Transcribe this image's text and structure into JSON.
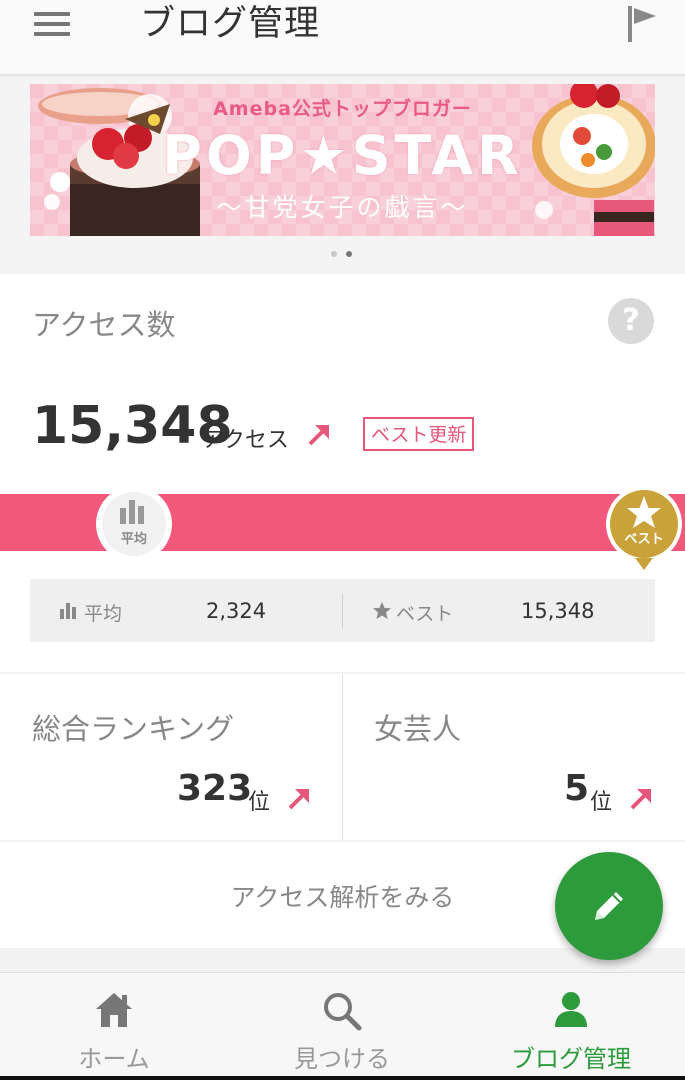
{
  "header": {
    "title": "ブログ管理",
    "menu_icon": "hamburger-menu-icon",
    "flag_icon": "flag-icon"
  },
  "banner": {
    "subtitle": "Ameba公式トップブロガー",
    "title": "POP★STAR",
    "tagline": "〜甘党女子の戯言〜",
    "current_slide": 2,
    "slide_count": 2
  },
  "access": {
    "section_label": "アクセス数",
    "help_icon": "?",
    "count": "15,348",
    "unit": "アクセス",
    "best_badge": "ベスト更新",
    "avg_marker_label": "平均",
    "best_marker_label": "ベスト",
    "avg_label": "平均",
    "avg_value": "2,324",
    "best_label": "ベスト",
    "best_value": "15,348",
    "bar_color": "#f2587a"
  },
  "ranking": {
    "overall_label": "総合ランキング",
    "overall_rank": "323",
    "rank_unit": "位",
    "category_label": "女芸人",
    "category_rank": "5"
  },
  "analysis": {
    "link_label": "アクセス解析をみる"
  },
  "fab": {
    "icon": "pencil-icon",
    "color": "#2d9b3c"
  },
  "nav": {
    "items": [
      {
        "label": "ホーム",
        "icon": "home-icon"
      },
      {
        "label": "見つける",
        "icon": "search-icon"
      },
      {
        "label": "ブログ管理",
        "icon": "person-icon"
      }
    ],
    "active_color": "#2d9b3c"
  }
}
